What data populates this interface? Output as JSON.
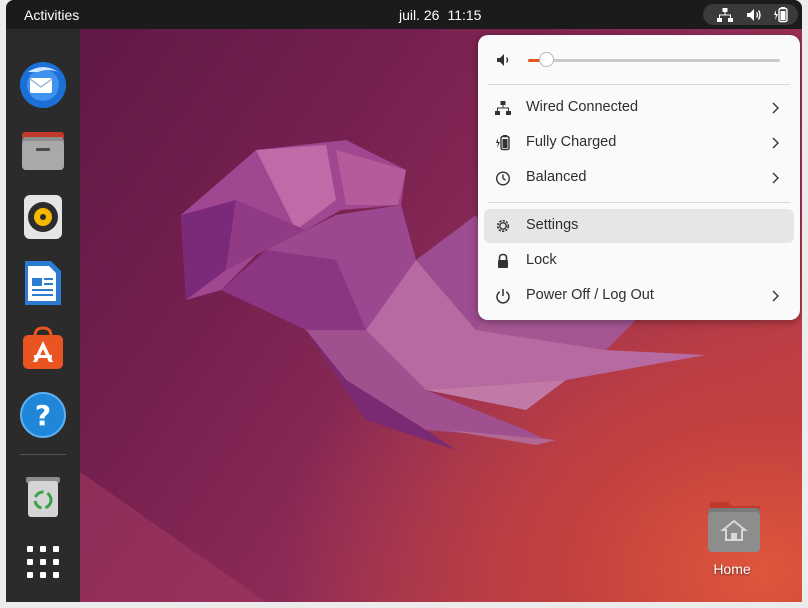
{
  "topbar": {
    "activities_label": "Activities",
    "date": "juil. 26",
    "time": "11:15",
    "tray_icons": [
      "network-wired-icon",
      "speaker-icon",
      "battery-icon"
    ]
  },
  "dock": {
    "apps": [
      {
        "name": "thunderbird-icon"
      },
      {
        "name": "files-icon"
      },
      {
        "name": "rhythmbox-icon"
      },
      {
        "name": "libreoffice-writer-icon"
      },
      {
        "name": "ubuntu-software-icon"
      },
      {
        "name": "help-icon"
      },
      {
        "name": "trash-icon"
      },
      {
        "name": "show-apps-icon"
      }
    ]
  },
  "system_menu": {
    "volume_percent": 7,
    "items": [
      {
        "label": "Wired Connected",
        "icon": "network-wired-icon",
        "has_submenu": true
      },
      {
        "label": "Fully Charged",
        "icon": "battery-charged-icon",
        "has_submenu": true
      },
      {
        "label": "Balanced",
        "icon": "power-profile-icon",
        "has_submenu": true
      },
      {
        "label": "Settings",
        "icon": "settings-icon",
        "has_submenu": false,
        "highlighted": true
      },
      {
        "label": "Lock",
        "icon": "lock-icon",
        "has_submenu": false
      },
      {
        "label": "Power Off / Log Out",
        "icon": "power-icon",
        "has_submenu": true
      }
    ]
  },
  "desktop": {
    "home_label": "Home"
  },
  "colors": {
    "accent": "#e95420",
    "topbar": "#1b1b1b",
    "dock": "#2b2b2b",
    "menu_bg": "#fafafa"
  }
}
